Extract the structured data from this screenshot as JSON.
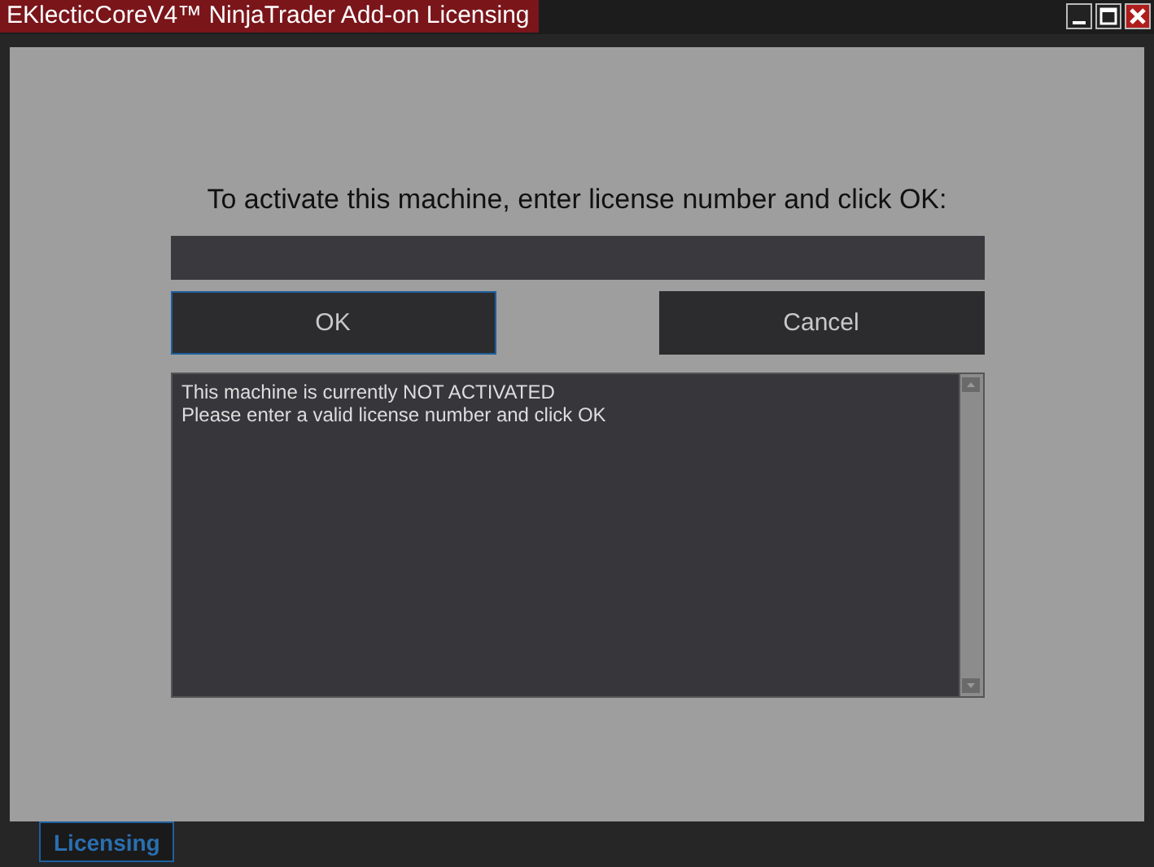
{
  "window": {
    "title": "EKlecticCoreV4™ NinjaTrader Add-on Licensing"
  },
  "prompt": "To activate this machine, enter license number and click OK:",
  "buttons": [
    {
      "label": "OK",
      "focused": true
    },
    {
      "label": "Cancel",
      "focused": false
    }
  ],
  "status_lines": [
    "This machine is currently NOT ACTIVATED",
    "Please enter a valid license number and click OK"
  ],
  "tabs": [
    {
      "label": "Licensing",
      "selected": true
    }
  ]
}
